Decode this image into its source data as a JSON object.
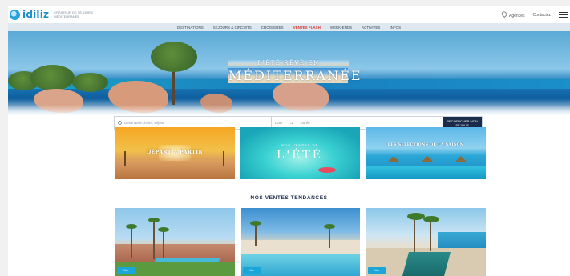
{
  "header": {
    "logo_text": "idiliz",
    "logo_tagline": "Créateur de séjours Méditerranée",
    "store_link": "Agences",
    "contact_link": "Contactez"
  },
  "nav": {
    "items": [
      {
        "label": "Destinations",
        "highlight": false
      },
      {
        "label": "Séjours & circuits",
        "highlight": false
      },
      {
        "label": "Croisières",
        "highlight": false
      },
      {
        "label": "Ventes flash",
        "highlight": true
      },
      {
        "label": "Week-ends",
        "highlight": false
      },
      {
        "label": "Activités",
        "highlight": false
      },
      {
        "label": "Infos",
        "highlight": false
      }
    ]
  },
  "hero": {
    "line1": "L'ÉTÉ RÊVÉ EN",
    "line2": "MÉDITERRANÉE"
  },
  "search": {
    "destination_placeholder": "Destination, hôtel, séjour",
    "date_from": "Date",
    "date_to": "Durée",
    "button_label": "Rechercher mon séjour"
  },
  "promos": [
    {
      "title": "DÉPART À PARTIR"
    },
    {
      "title_small": "Nos ventes de",
      "title_big": "L'ÉTÉ"
    },
    {
      "title": "Les sélections de la saison"
    }
  ],
  "section_title": "Nos ventes tendances",
  "listings": [
    {
      "badge": "Voir"
    },
    {
      "badge": "Voir"
    },
    {
      "badge": "Voir"
    }
  ],
  "colors": {
    "brand": "#1a8fc9",
    "nav_highlight": "#d43a3a",
    "search_button": "#1b2b4a",
    "badge": "#1aa6d8"
  }
}
